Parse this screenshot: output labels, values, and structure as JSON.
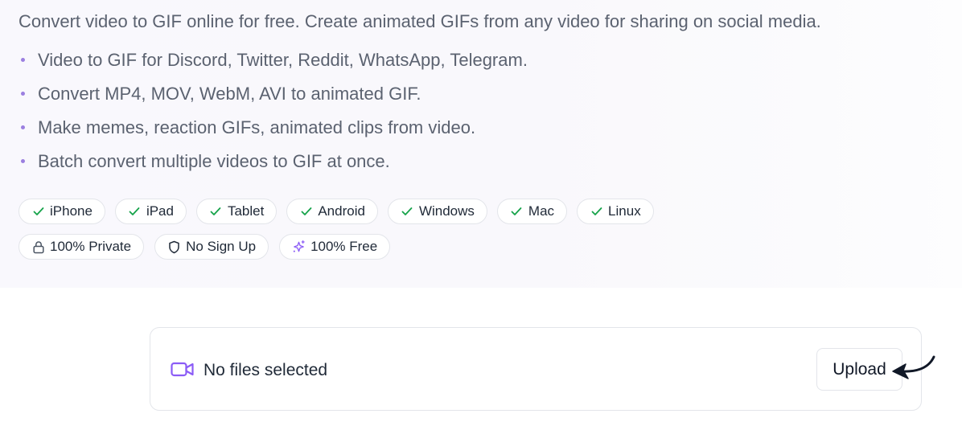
{
  "intro": "Convert video to GIF online for free. Create animated GIFs from any video for sharing on social media.",
  "features": [
    "Video to GIF for Discord, Twitter, Reddit, WhatsApp, Telegram.",
    "Convert MP4, MOV, WebM, AVI to animated GIF.",
    "Make memes, reaction GIFs, animated clips from video.",
    "Batch convert multiple videos to GIF at once."
  ],
  "platforms": [
    {
      "label": "iPhone",
      "icon": "check-icon"
    },
    {
      "label": "iPad",
      "icon": "check-icon"
    },
    {
      "label": "Tablet",
      "icon": "check-icon"
    },
    {
      "label": "Android",
      "icon": "check-icon"
    },
    {
      "label": "Windows",
      "icon": "check-icon"
    },
    {
      "label": "Mac",
      "icon": "check-icon"
    },
    {
      "label": "Linux",
      "icon": "check-icon"
    }
  ],
  "perks": [
    {
      "label": "100% Private",
      "icon": "lock-icon"
    },
    {
      "label": "No Sign Up",
      "icon": "shield-icon"
    },
    {
      "label": "100% Free",
      "icon": "sparkles-icon"
    }
  ],
  "upload": {
    "status": "No files selected",
    "button_label": "Upload",
    "icon": "video-camera-icon"
  },
  "colors": {
    "accent": "#8b5cf6",
    "check": "#16a34a",
    "text_muted": "#5b6270",
    "text_dark": "#1f2937",
    "border": "#e3e5ea"
  }
}
